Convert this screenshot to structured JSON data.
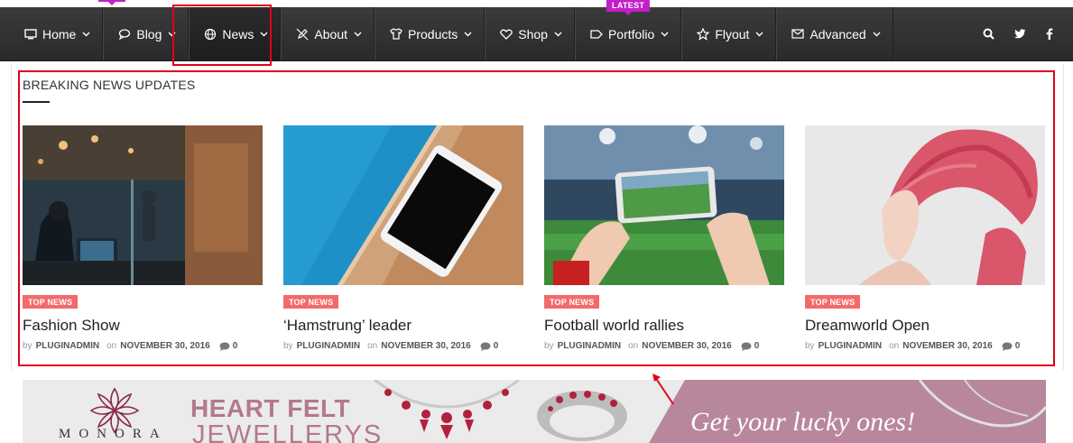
{
  "nav": {
    "items": [
      {
        "label": "Home",
        "icon": "monitor-icon"
      },
      {
        "label": "Blog",
        "icon": "speech-bubble-icon"
      },
      {
        "label": "News",
        "icon": "globe-icon"
      },
      {
        "label": "About",
        "icon": "pencil-slash-icon"
      },
      {
        "label": "Products",
        "icon": "tshirt-icon"
      },
      {
        "label": "Shop",
        "icon": "heart-icon"
      },
      {
        "label": "Portfolio",
        "icon": "tag-icon",
        "badge": "LATEST"
      },
      {
        "label": "Flyout",
        "icon": "star-icon"
      },
      {
        "label": "Advanced",
        "icon": "envelope-icon"
      }
    ],
    "right_icons": [
      "search-icon",
      "twitter-icon",
      "facebook-icon"
    ]
  },
  "mega": {
    "title": "BREAKING NEWS UPDATES",
    "cards": [
      {
        "tag": "TOP NEWS",
        "title": "Fashion Show",
        "by": "by",
        "author": "PLUGINADMIN",
        "on": "on",
        "date": "NOVEMBER 30, 2016",
        "comments": "0"
      },
      {
        "tag": "TOP NEWS",
        "title": "‘Hamstrung’ leader",
        "by": "by",
        "author": "PLUGINADMIN",
        "on": "on",
        "date": "NOVEMBER 30, 2016",
        "comments": "0"
      },
      {
        "tag": "TOP NEWS",
        "title": "Football world rallies",
        "by": "by",
        "author": "PLUGINADMIN",
        "on": "on",
        "date": "NOVEMBER 30, 2016",
        "comments": "0"
      },
      {
        "tag": "TOP NEWS",
        "title": "Dreamworld Open",
        "by": "by",
        "author": "PLUGINADMIN",
        "on": "on",
        "date": "NOVEMBER 30, 2016",
        "comments": "0"
      }
    ]
  },
  "banner": {
    "brand": "MONORA",
    "heading": "HEART FELT",
    "subheading": "JEWELLERYS",
    "cta": "Get your lucky ones!"
  },
  "colors": {
    "nav_bg": "#2f2f2f",
    "badge": "#c41ec8",
    "tag": "#f36a6a",
    "annotation": "#e0001b",
    "banner_accent": "#b3788f"
  }
}
